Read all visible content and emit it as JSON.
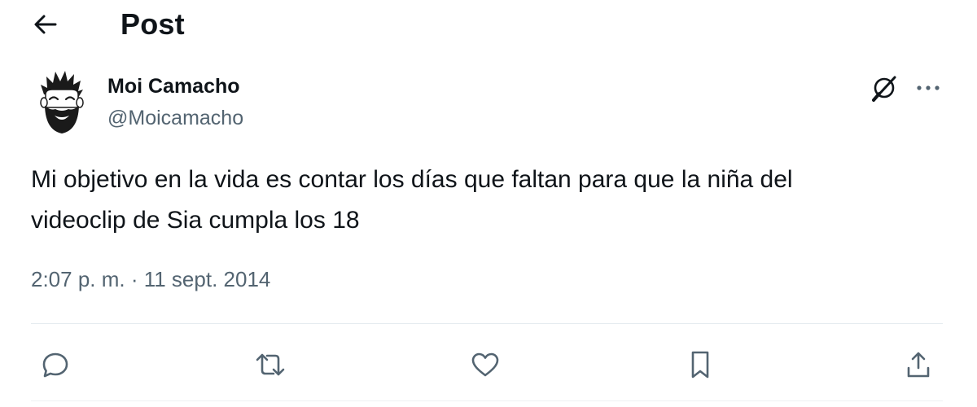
{
  "header": {
    "title": "Post",
    "back_icon": "arrow-left-icon"
  },
  "author": {
    "display_name": "Moi Camacho",
    "handle": "@Moicamacho",
    "avatar": "cartoon-bearded-man-avatar"
  },
  "post": {
    "text_line1": "Mi objetivo en la vida es contar los días que faltan para que la niña del",
    "text_line2": "videoclip de Sia cumpla los 18",
    "timestamp": "2:07 p. m. · 11 sept. 2014"
  },
  "toolbar_icons": {
    "grok": "grok-icon",
    "more": "more-dots-icon"
  },
  "actions": [
    {
      "name": "reply",
      "icon": "reply-icon"
    },
    {
      "name": "repost",
      "icon": "repost-icon"
    },
    {
      "name": "like",
      "icon": "heart-icon"
    },
    {
      "name": "bookmark",
      "icon": "bookmark-icon"
    },
    {
      "name": "share",
      "icon": "share-icon"
    }
  ],
  "colors": {
    "text": "#0f1419",
    "secondary": "#536471",
    "divider": "#e6ecf0"
  }
}
